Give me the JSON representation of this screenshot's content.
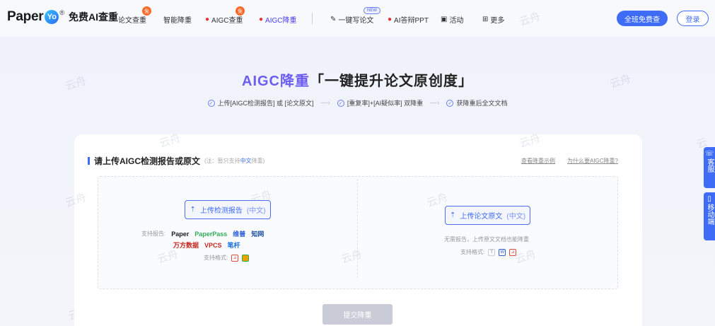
{
  "header": {
    "logo_text": "Paper",
    "logo_mark": "Yo",
    "logo_reg": "®",
    "logo_sub": "免费AI查重",
    "nav": {
      "paper_check": "论文查重",
      "smart_reduce": "智能降重",
      "aigc_check": "AIGC查重",
      "aigc_reduce": "AIGC降重",
      "write_paper": "一键写论文",
      "ppt": "AI答辩PPT",
      "activity": "活动",
      "more": "更多"
    },
    "badge_free": "免",
    "badge_new": "NEW",
    "btn_check": "全班免费查",
    "btn_login": "登录",
    "accent": "#3e6cf6"
  },
  "hero": {
    "title_hl": "AIGC降重",
    "title_rest": "「一键提升论文原创度」",
    "step1": "上传[AIGC检测报告] 或 [论文原文]",
    "step2": "[重复率]+[AI疑似率] 双降重",
    "step3": "获降重后全文文档"
  },
  "card": {
    "title": "请上传AIGC检测报告或原文",
    "note_pre": "(注：暂只支持",
    "note_em": "中文",
    "note_post": "降重)",
    "link_example": "查看降重示例",
    "link_why": "为什么要AIGC降重?",
    "left": {
      "upload_label": "上传检测报告",
      "upload_muted": "(中文)",
      "support_label": "支持报告:",
      "brands_row1": [
        "Paper",
        "PaperPass",
        "维普",
        "知网"
      ],
      "brands_row2": [
        "万方数据",
        "VPCS",
        "笔杆"
      ],
      "format_label": "支持格式:"
    },
    "right": {
      "upload_label": "上传论文原文",
      "upload_muted": "(中文)",
      "no_report": "无需报告，上传原文文档也能降重",
      "format_label": "支持格式:"
    },
    "submit": "提交降重"
  },
  "side": {
    "service": "客服",
    "mobile": "移动端"
  },
  "watermark": "云舟"
}
